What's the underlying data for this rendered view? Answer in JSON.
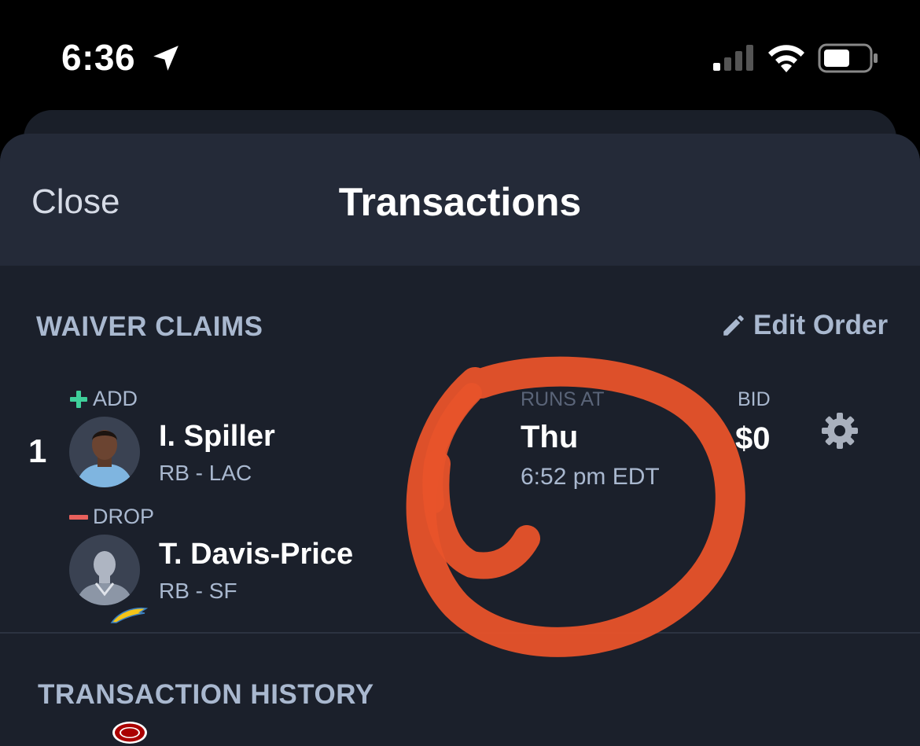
{
  "status_bar": {
    "time": "6:36",
    "icons": [
      "location-arrow-icon",
      "cellular-signal-icon",
      "wifi-icon",
      "battery-icon"
    ]
  },
  "sheet": {
    "close_label": "Close",
    "title": "Transactions"
  },
  "waiver_claims": {
    "section_title": "WAIVER CLAIMS",
    "edit_order_label": "Edit Order",
    "claims": [
      {
        "rank": "1",
        "add": {
          "label": "ADD",
          "name": "I. Spiller",
          "meta": "RB - LAC",
          "team_icon": "chargers-logo-icon"
        },
        "drop": {
          "label": "DROP",
          "name": "T. Davis-Price",
          "meta": "RB - SF",
          "team_icon": "49ers-logo-icon"
        },
        "runs_at_label": "RUNS AT",
        "runs_day": "Thu",
        "runs_time": "6:52 pm EDT",
        "bid_label": "BID",
        "bid_value": "$0"
      }
    ]
  },
  "transaction_history": {
    "section_title": "TRANSACTION HISTORY"
  },
  "colors": {
    "sheet_bg": "#1b202b",
    "header_bg": "#242a38",
    "accent_text": "#a9b8cf",
    "add_green": "#3fcf9a",
    "drop_red": "#e8605c",
    "annotation_orange": "#e8532a"
  }
}
